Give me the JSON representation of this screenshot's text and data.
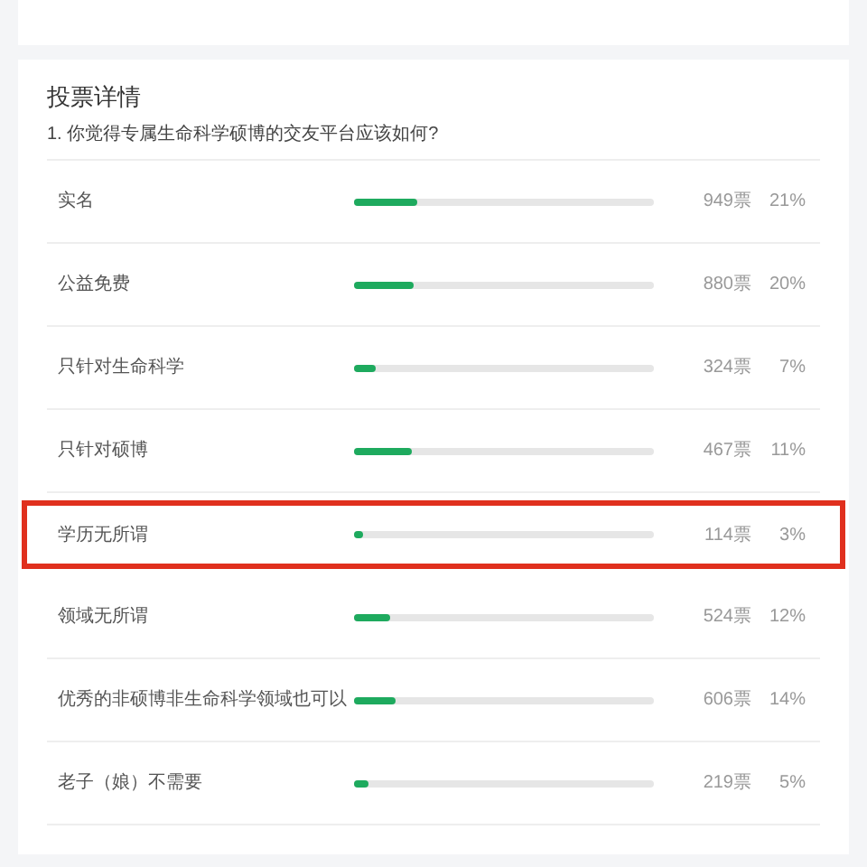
{
  "section": {
    "title": "投票详情",
    "question": "1. 你觉得专属生命科学硕博的交友平台应该如何?"
  },
  "options": [
    {
      "label": "实名",
      "level": 0.21,
      "votes": "949票",
      "percent": "21%",
      "highlighted": false
    },
    {
      "label": "公益免费",
      "level": 0.2,
      "votes": "880票",
      "percent": "20%",
      "highlighted": false
    },
    {
      "label": "只针对生命科学",
      "level": 0.07,
      "votes": "324票",
      "percent": "7%",
      "highlighted": false
    },
    {
      "label": "只针对硕博",
      "level": 0.19,
      "votes": "467票",
      "percent": "11%",
      "highlighted": false
    },
    {
      "label": "学历无所谓",
      "level": 0.03,
      "votes": "114票",
      "percent": "3%",
      "highlighted": true
    },
    {
      "label": "领域无所谓",
      "level": 0.12,
      "votes": "524票",
      "percent": "12%",
      "highlighted": false
    },
    {
      "label": "优秀的非硕博非生命科学领域也可以",
      "level": 0.14,
      "votes": "606票",
      "percent": "14%",
      "highlighted": false
    },
    {
      "label": "老子（娘）不需要",
      "level": 0.05,
      "votes": "219票",
      "percent": "5%",
      "highlighted": false
    }
  ]
}
